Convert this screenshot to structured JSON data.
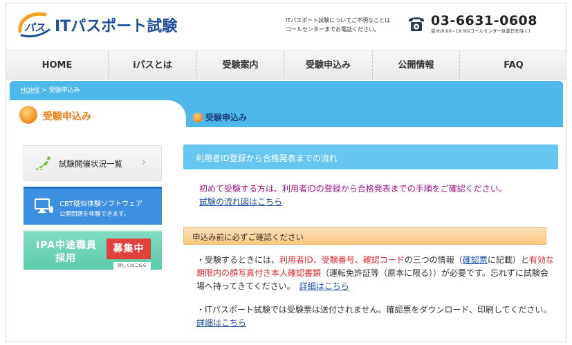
{
  "header": {
    "logo_mark": "パス",
    "logo_text": "ITパスポート試験",
    "notice_line1": "ITパスポート試験についてご不明なことは",
    "notice_line2": "コールセンターまでお電話ください。",
    "phone": "03-6631-0608",
    "hours": "受付/8:00~19:00(コールセンター休業日を除く)",
    "phone_icon": "telephone-icon"
  },
  "nav": {
    "items": [
      "HOME",
      "iパスとは",
      "受験案内",
      "受験申込み",
      "公開情報",
      "FAQ"
    ]
  },
  "breadcrumb": {
    "home": "HOME",
    "separator": " > ",
    "current": "受験申込み"
  },
  "tabs": {
    "active": "受験申込み",
    "second": "受験申込み"
  },
  "sidebar": {
    "status_label": "試験開催状況一覧",
    "status_chevron": "›",
    "cbt_title": "CBT疑似体験ソフトウェア",
    "cbt_sub": "公開問題を体験できます。",
    "ipa_line1": "IPA中途職員",
    "ipa_line2": "採用",
    "ipa_badge": "募集中",
    "ipa_more": "詳しくはこちら"
  },
  "main": {
    "section_title": "利用者ID登録から合格発表までの流れ",
    "intro_text": "初めて受験する方は、利用者IDの登録から合格発表までの手順をご確認ください。",
    "intro_link": "試験の流れ図はこちら",
    "warning_title": "申込み前に必ずご確認ください",
    "p1_a": "・受験するときには、",
    "p1_red1": "利用者ID、受験番号、確認コード",
    "p1_b": "の三つの情報（",
    "p1_link1": "確認票",
    "p1_c": "に記載）と",
    "p1_red2": "有効な期限内の顔写真付き本人確認書類",
    "p1_d": "（運転免許証等（原本に限る））が必要です。忘れずに試験会場へ持ってきてください。",
    "p1_link2": "詳細はこちら",
    "p2_a": "・ITパスポート試験では受験票は送付されません。確認票をダウンロード、印刷してください。",
    "p2_link": "詳細はこちら"
  },
  "colors": {
    "brand_blue": "#1c4e9c",
    "bar_blue": "#4fb8ea",
    "accent_orange": "#f07d14",
    "alert_red": "#e0262d",
    "intro_magenta": "#a0168a"
  }
}
